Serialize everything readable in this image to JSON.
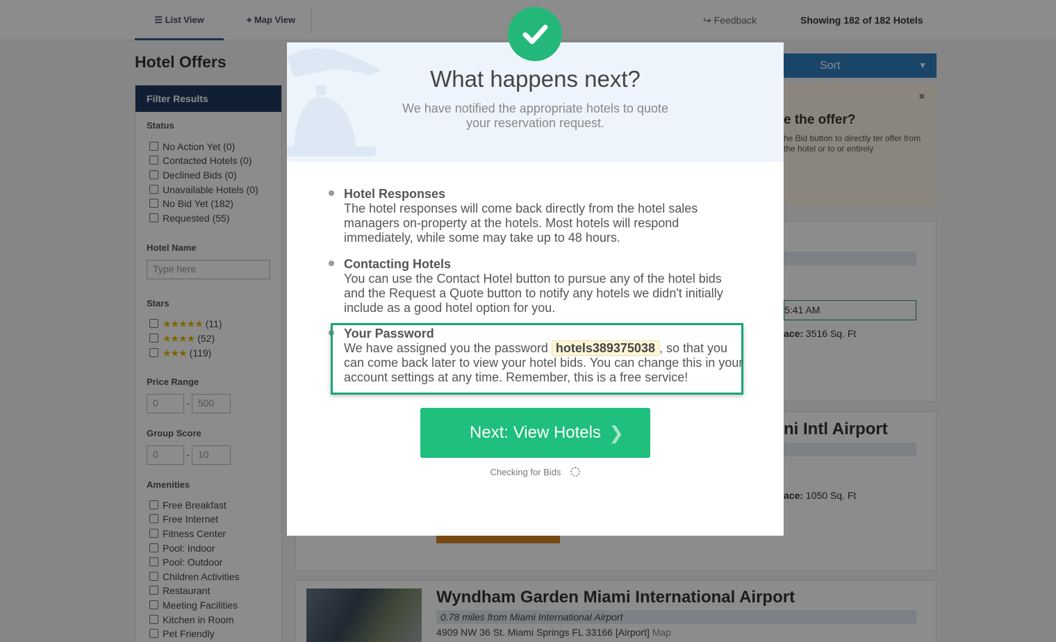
{
  "topbar": {
    "list_view": "List View",
    "map_view": "Map View",
    "feedback": "Feedback",
    "showing": "Showing 182 of 182 Hotels"
  },
  "page_title": "Hotel Offers",
  "sort_label": "Sort",
  "sidebar": {
    "header": "Filter Results",
    "status_title": "Status",
    "status_items": [
      "No Action Yet (0)",
      "Contacted Hotels (0)",
      "Declined Bids (0)",
      "Unavailable Hotels (0)",
      "No Bid Yet (182)",
      "Requested (55)"
    ],
    "hotel_name_title": "Hotel Name",
    "hotel_name_placeholder": "Type here",
    "stars_title": "Stars",
    "stars_items": [
      {
        "stars": "★★★★★",
        "count": "(11)"
      },
      {
        "stars": "★★★★",
        "count": "(52)"
      },
      {
        "stars": "★★★",
        "count": "(119)"
      }
    ],
    "price_title": "Price Range",
    "price_min": "0",
    "price_max": "500",
    "group_title": "Group Score",
    "group_min": "0",
    "group_max": "10",
    "amenities_title": "Amenities",
    "amenities": [
      "Free Breakfast",
      "Free Internet",
      "Fitness Center",
      "Pool: Indoor",
      "Pool: Outdoor",
      "Children Activities",
      "Restaurant",
      "Meeting Facilities",
      "Kitchen in Room",
      "Pet Friendly"
    ]
  },
  "promo": {
    "title": "e the offer?",
    "text": "he Bid button to directly ter offer from the hotel or to or entirely"
  },
  "background_cards": {
    "time_text": "5:41 AM",
    "space1_label": "ace:",
    "space1_value": "3516 Sq. Ft",
    "hotel2_name_fragment": "ni Intl Airport",
    "space2_label": "ace:",
    "space2_value": "1050 Sq. Ft",
    "hotel3_name": "Wyndham Garden Miami International Airport",
    "hotel3_distance": "0.78 miles from Miami International Airport",
    "hotel3_address": "4909 NW 36 St. Miami Springs FL 33166 [Airport]",
    "hotel3_map_link": "Map"
  },
  "modal": {
    "title": "What happens next?",
    "subtitle": "We have notified the appropriate hotels to quote your reservation request.",
    "sections": [
      {
        "title": "Hotel Responses",
        "text": "The hotel responses will come back directly from the hotel sales managers on-property at the hotels. Most hotels will respond immediately, while some may take up to 48 hours."
      },
      {
        "title": "Contacting Hotels",
        "text": "You can use the Contact Hotel button to pursue any of the hotel bids and the Request a Quote button to notify any hotels we didn't initially include as a good hotel option for you."
      }
    ],
    "password_title": "Your Password",
    "password_pre": "We have assigned you the password ",
    "password_value": "hotels389375038",
    "password_post": ", so that you can come back later to view your hotel bids. You can change this in your account settings at any time. Remember, this is a free service!",
    "next_button": "Next: View Hotels",
    "checking": "Checking for Bids"
  },
  "colors": {
    "accent_green": "#1fbf7d",
    "check_green": "#23b87a",
    "sort_blue": "#2f7fc0",
    "filter_navy": "#1e3a5f"
  }
}
